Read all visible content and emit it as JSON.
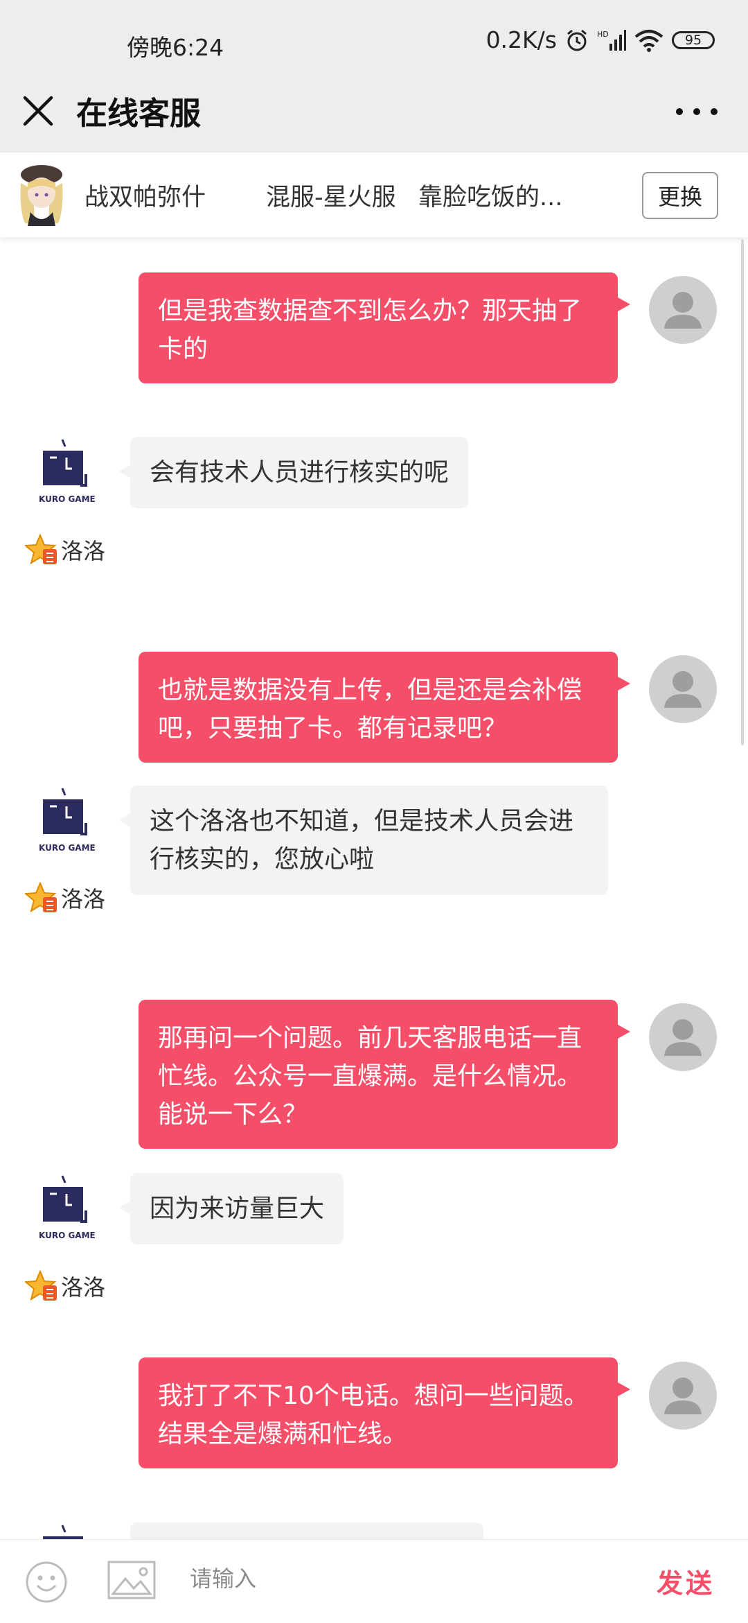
{
  "status_bar": {
    "time": "傍晚6:24",
    "network_speed": "0.2K/s",
    "battery": "95"
  },
  "header": {
    "title": "在线客服"
  },
  "game_bar": {
    "game": "战双帕弥什",
    "server": "混服-星火服",
    "character": "靠脸吃饭的...",
    "switch_label": "更换"
  },
  "messages": [
    {
      "from": "user",
      "text": "但是我查数据查不到怎么办？那天抽了卡的"
    },
    {
      "from": "agent",
      "text": "会有技术人员进行核实的呢",
      "agent_name": "洛洛"
    },
    {
      "from": "user",
      "text": "也就是数据没有上传，但是还是会补偿吧，只要抽了卡。都有记录吧？"
    },
    {
      "from": "agent",
      "text": "这个洛洛也不知道，但是技术人员会进行核实的，您放心啦",
      "agent_name": "洛洛"
    },
    {
      "from": "user",
      "text": "那再问一个问题。前几天客服电话一直忙线。公众号一直爆满。是什么情况。能说一下么？"
    },
    {
      "from": "agent",
      "text": "因为来访量巨大",
      "agent_name": "洛洛"
    },
    {
      "from": "user",
      "text": "我打了不下10个电话。想问一些问题。结果全是爆满和忙线。"
    }
  ],
  "input_bar": {
    "placeholder": "请输入",
    "send_label": "发送"
  },
  "colors": {
    "accent": "#f44e68",
    "agent_bubble": "#f3f3f3",
    "header_bg": "#ededed"
  }
}
